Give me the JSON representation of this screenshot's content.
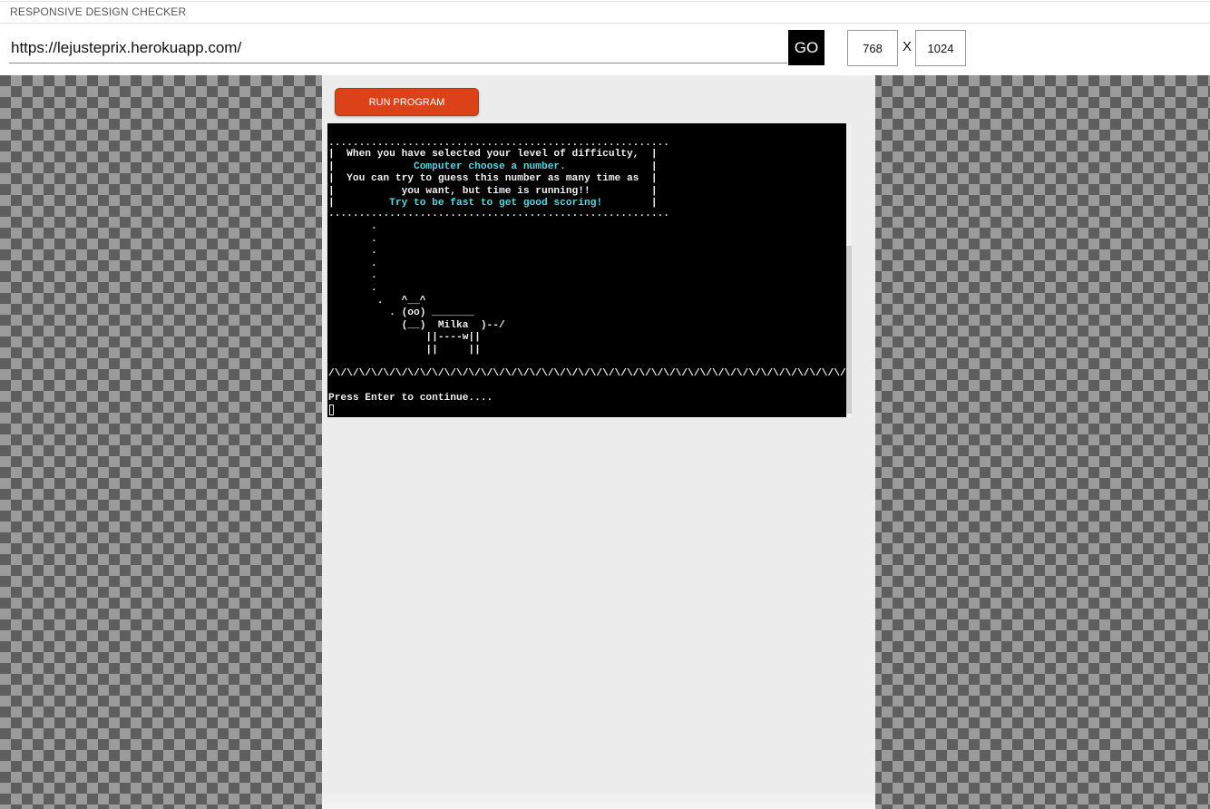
{
  "app": {
    "title": "RESPONSIVE DESIGN CHECKER"
  },
  "toolbar": {
    "url_value": "https://lejusteprix.herokuapp.com/",
    "go_label": "GO",
    "width_value": "768",
    "dim_separator": "X",
    "height_value": "1024"
  },
  "device": {
    "run_label": "RUN PROGRAM"
  },
  "terminal": {
    "line_top_border": "........................................................",
    "line_1": "|  When you have selected your level of difficulty,  |",
    "line_2_pre": "|             ",
    "line_2_text": "Computer choose a number.",
    "line_2_post": "              |",
    "line_3": "|  You can try to guess this number as many time as  |",
    "line_4": "|           you want, but time is running!!          |",
    "line_5_pre": "|         ",
    "line_5_text": "Try to be fast to get good scoring!",
    "line_5_post": "        |",
    "line_bottom_border": "........................................................",
    "cow_art": "       .\n       .\n       .\n       .\n       .\n       .\n        .   ^__^\n          . (oo) _______\n            (__)  Milka  )--/\n                ||----w||\n                ||     ||",
    "grass": "/\\/\\/\\/\\/\\/\\/\\/\\/\\/\\/\\/\\/\\/\\/\\/\\/\\/\\/\\/\\/\\/\\/\\/\\/\\/\\/\\/\\/\\/\\/\\/\\/\\/\\/\\/\\/\\/\\/\\/\\/\\/\\/\\/\\/\\/\\/\\/\\/\\/\\",
    "prompt": "Press Enter to continue...."
  }
}
